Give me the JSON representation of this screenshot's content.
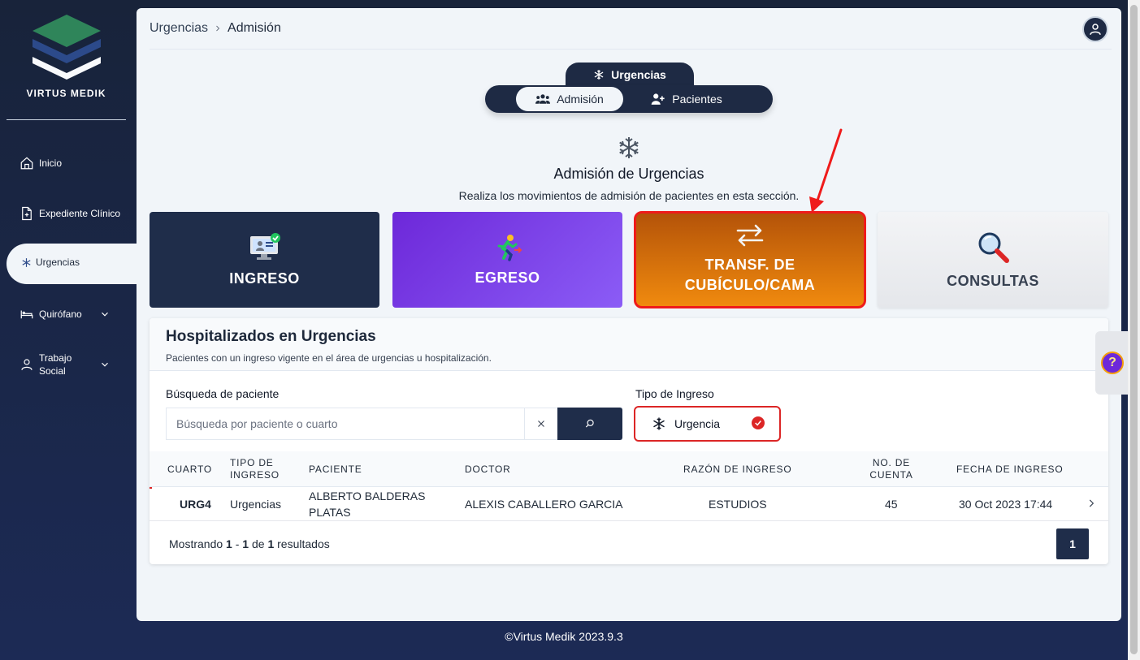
{
  "brand": {
    "name": "VIRTUS MEDIK"
  },
  "sidebar": {
    "items": [
      {
        "label": "Inicio",
        "icon": "home-icon"
      },
      {
        "label": "Expediente Clínico",
        "icon": "file-plus-icon"
      },
      {
        "label": "Urgencias",
        "icon": "snowflake-icon",
        "active": true
      },
      {
        "label": "Quirófano",
        "icon": "bed-icon",
        "expandable": true
      },
      {
        "label": "Trabajo Social",
        "label_lines": [
          "Trabajo",
          "Social"
        ],
        "icon": "user-icon",
        "expandable": true
      }
    ]
  },
  "header": {
    "breadcrumb": [
      "Urgencias",
      "Admisión"
    ],
    "avatar_icon": "user-circle-icon"
  },
  "tabs": {
    "parent": "Urgencias",
    "items": [
      {
        "label": "Admisión",
        "icon": "users-icon",
        "active": true
      },
      {
        "label": "Pacientes",
        "icon": "user-plus-icon",
        "active": false
      }
    ]
  },
  "hero": {
    "title": "Admisión de Urgencias",
    "subtitle": "Realiza los movimientos de admisión de pacientes en esta sección."
  },
  "cards": {
    "ingreso": "INGRESO",
    "egreso": "EGRESO",
    "transf_line1": "TRANSF. DE",
    "transf_line2": "CUBÍCULO/CAMA",
    "consultas": "CONSULTAS"
  },
  "panel": {
    "title": "Hospitalizados en Urgencias",
    "subtitle": "Pacientes con un ingreso vigente en el área de urgencias u hospitalización.",
    "search_label": "Búsqueda de paciente",
    "search_placeholder": "Búsqueda por paciente o cuarto",
    "search_value": "",
    "tipo_label": "Tipo de Ingreso",
    "tipo_value": "Urgencia"
  },
  "table": {
    "headers": {
      "cuarto": "CUARTO",
      "tipo_1": "TIPO DE",
      "tipo_2": "INGRESO",
      "paciente": "PACIENTE",
      "doctor": "DOCTOR",
      "razon": "RAZÓN DE INGRESO",
      "cuenta_1": "NO. DE",
      "cuenta_2": "CUENTA",
      "fecha": "FECHA DE INGRESO"
    },
    "rows": [
      {
        "cuarto": "URG4",
        "tipo": "Urgencias",
        "paciente_1": "ALBERTO BALDERAS",
        "paciente_2": "PLATAS",
        "doctor": "ALEXIS CABALLERO GARCIA",
        "razon": "ESTUDIOS",
        "cuenta": "45",
        "fecha": "30 Oct 2023 17:44"
      }
    ],
    "footer": {
      "pre": "Mostrando ",
      "from": "1",
      "mid1": " - ",
      "to": "1",
      "mid2": " de ",
      "total": "1",
      "post": " resultados"
    },
    "page": "1"
  },
  "help": {
    "label": "?"
  },
  "footer": {
    "copyright": "©Virtus Medik 2023.9.3"
  },
  "colors": {
    "navy": "#1f2d4a",
    "purple": "#7c3aed",
    "orange": "#f08a0e",
    "highlight_red": "#ef1b1b",
    "bg": "#f1f5f9"
  }
}
